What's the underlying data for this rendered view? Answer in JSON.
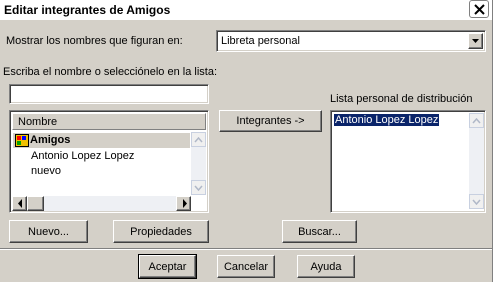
{
  "window": {
    "title": "Editar integrantes de Amigos"
  },
  "show_names": {
    "label": "Mostrar los nombres que figuran en:",
    "selected": "Libreta personal"
  },
  "search": {
    "label": "Escriba el nombre o selecciónelo en la lista:",
    "value": ""
  },
  "names_list": {
    "column_header": "Nombre",
    "items": [
      {
        "label": "Amigos",
        "icon": "distribution-list-icon",
        "bold": true,
        "selected": true
      },
      {
        "label": "Antonio Lopez Lopez"
      },
      {
        "label": "nuevo"
      }
    ]
  },
  "buttons": {
    "members": "Integrantes ->",
    "new": "Nuevo...",
    "properties": "Propiedades",
    "search": "Buscar...",
    "accept": "Aceptar",
    "cancel": "Cancelar",
    "help": "Ayuda"
  },
  "distribution_list": {
    "label": "Lista personal de distribución",
    "items": [
      {
        "label": "Antonio Lopez Lopez",
        "selected": true
      }
    ]
  },
  "colors": {
    "selection": "#0a246a",
    "window": "#d4d0c8"
  }
}
